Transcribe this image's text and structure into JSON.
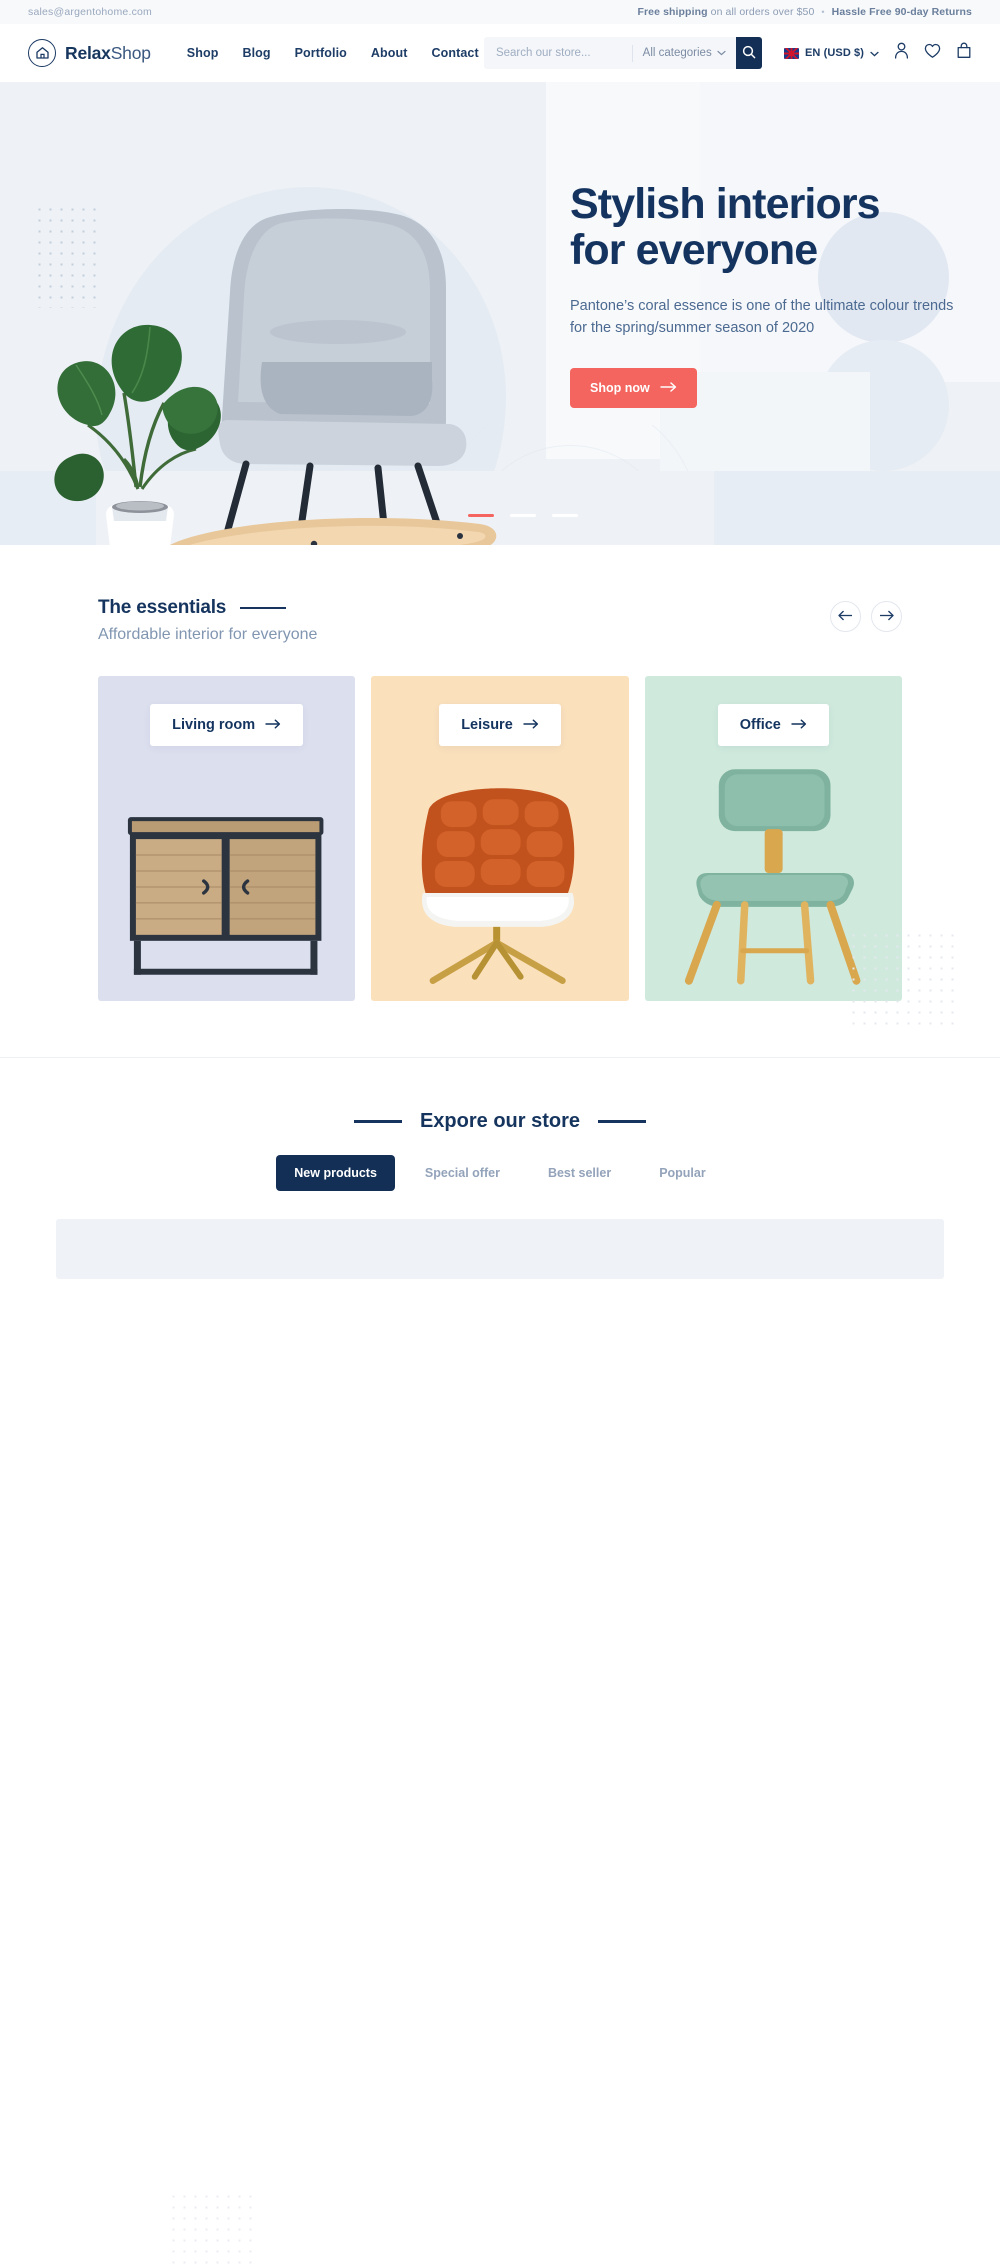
{
  "topbar": {
    "email": "sales@argentohome.com",
    "promo_strong": "Free shipping",
    "promo_rest": " on all orders over $50",
    "separator": "•",
    "returns": "Hassle Free 90-day Returns"
  },
  "header": {
    "logo_bold": "Relax",
    "logo_light": "Shop",
    "logo_icon": "house-in-circle-icon",
    "nav": [
      {
        "label": "Shop"
      },
      {
        "label": "Blog"
      },
      {
        "label": "Portfolio"
      },
      {
        "label": "About"
      },
      {
        "label": "Contact"
      }
    ],
    "search": {
      "placeholder": "Search our store...",
      "value": "",
      "category_selected": "All categories",
      "search_icon": "magnifier-icon",
      "chevron_icon": "chevron-down-icon"
    },
    "actions": {
      "language": "EN (USD $)",
      "flag_icon": "uk-flag-icon",
      "account_icon": "user-icon",
      "wishlist_icon": "heart-icon",
      "cart_icon": "shopping-bag-icon"
    }
  },
  "hero": {
    "title_line1": "Stylish interiors",
    "title_line2": "for everyone",
    "subtitle": "Pantone’s coral essence is one of the ultimate colour trends for the spring/summer season of 2020",
    "cta_label": "Shop now",
    "cta_icon": "arrow-right-icon",
    "cta_color": "#f4655f",
    "slides_total": 3,
    "slide_active": 1
  },
  "essentials": {
    "title": "The essentials",
    "subtitle": "Affordable interior for everyone",
    "prev_icon": "arrow-left-icon",
    "next_icon": "arrow-right-icon",
    "cards": [
      {
        "label": "Living room",
        "bg": "#dcdfee",
        "art": "wooden-sideboard"
      },
      {
        "label": "Leisure",
        "bg": "#fae0bb",
        "art": "orange-lounge-chair"
      },
      {
        "label": "Office",
        "bg": "#cfe9dd",
        "art": "green-office-chair"
      }
    ]
  },
  "explore": {
    "title": "Expore our store",
    "tabs": [
      {
        "label": "New products",
        "active": true
      },
      {
        "label": "Special offer",
        "active": false
      },
      {
        "label": "Best seller",
        "active": false
      },
      {
        "label": "Popular",
        "active": false
      }
    ]
  },
  "colors": {
    "navy": "#15345e",
    "coral": "#f4655f",
    "muted": "#8196b1",
    "hero_bg": "#eef1f5"
  }
}
